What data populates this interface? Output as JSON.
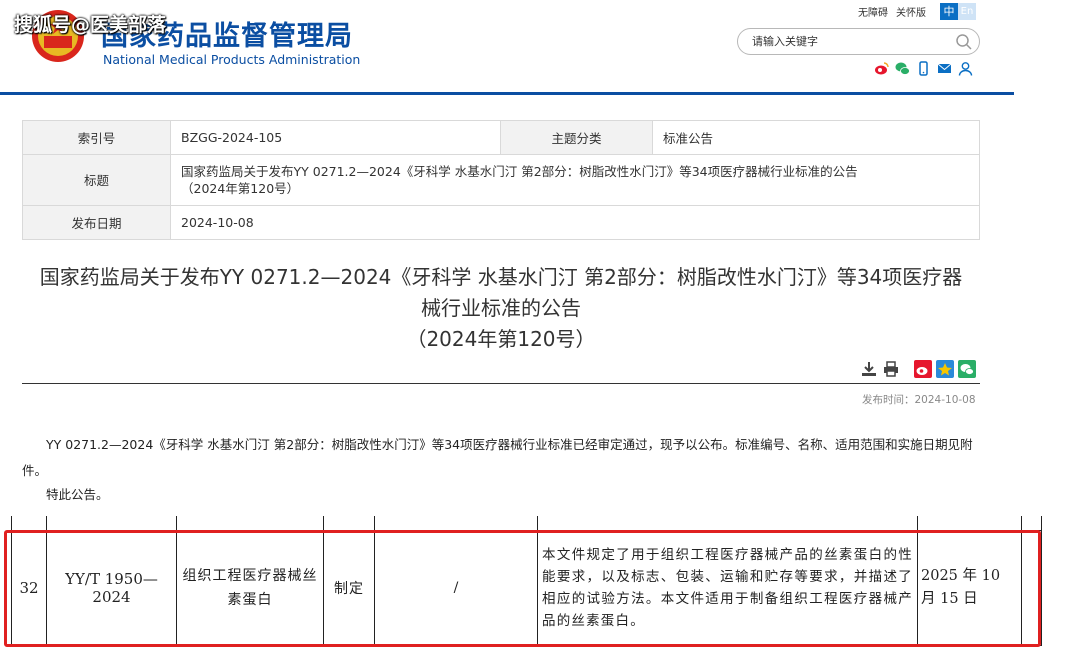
{
  "watermark": "搜狐号@医美部落",
  "site": {
    "name_cn": "国家药品监督管理局",
    "name_en": "National Medical Products Administration",
    "top_links": [
      "无障碍",
      "关怀版"
    ],
    "lang_zh": "中",
    "lang_en": "En",
    "search_placeholder": "请输入关键字",
    "colors": {
      "brand": "#0b4ea2",
      "red_highlight": "#e02020"
    }
  },
  "info": {
    "index_label": "索引号",
    "index_value": "BZGG-2024-105",
    "topic_label": "主题分类",
    "topic_value": "标准公告",
    "title_label": "标题",
    "title_value_line1": "国家药监局关于发布YY 0271.2—2024《牙科学 水基水门汀 第2部分：树脂改性水门汀》等34项医疗器械行业标准的公告",
    "title_value_line2": "（2024年第120号）",
    "date_label": "发布日期",
    "date_value": "2024-10-08"
  },
  "article": {
    "title_line1": "国家药监局关于发布YY 0271.2—2024《牙科学 水基水门汀 第2部分：树脂改性水门汀》等34项医疗器",
    "title_line2": "械行业标准的公告",
    "title_line3": "（2024年第120号）",
    "pubtime_label": "发布时间：",
    "pubtime_value": "2024-10-08",
    "paragraph": "YY 0271.2—2024《牙科学 水基水门汀 第2部分：树脂改性水门汀》等34项医疗器械行业标准已经审定通过，现予以公布。标准编号、名称、适用范围和实施日期见附件。",
    "closing": "特此公告。"
  },
  "standard_row": {
    "num": "32",
    "code": "YY/T 1950—2024",
    "name": "组织工程医疗器械丝素蛋白",
    "type": "制定",
    "replaces": "/",
    "scope": "本文件规定了用于组织工程医疗器械产品的丝素蛋白的性能要求，以及标志、包装、运输和贮存等要求，并描述了相应的试验方法。本文件适用于制备组织工程医疗器械产品的丝素蛋白。",
    "date": "2025 年 10 月 15 日"
  }
}
